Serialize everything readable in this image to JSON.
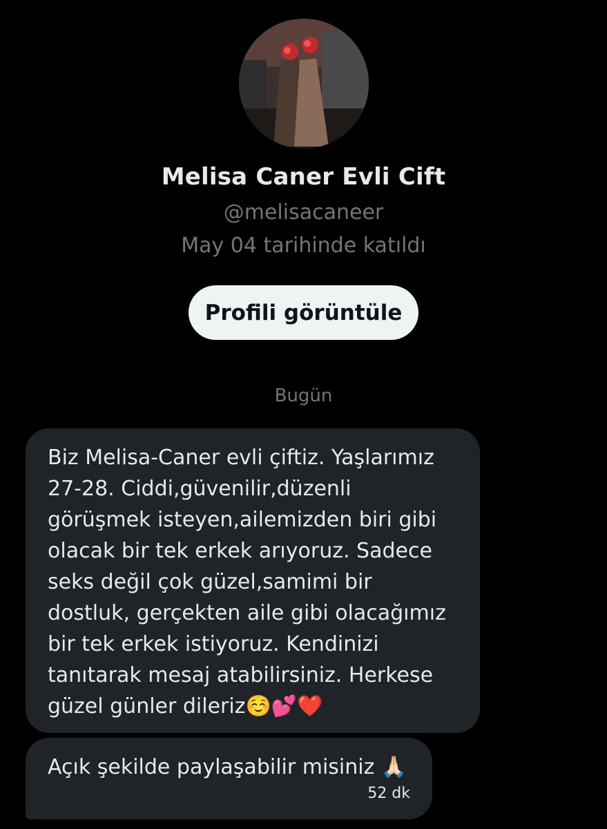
{
  "profile": {
    "display_name": "Melisa Caner Evli Cift",
    "handle": "@melisacaneer",
    "joined": "May 04 tarihinde katıldı",
    "view_profile_label": "Profili görüntüle"
  },
  "conversation": {
    "day_separator": "Bugün",
    "messages": [
      {
        "lines": [
          "Biz Melisa-Caner evli çiftiz. Yaşlarımız",
          "27-28. Ciddi,güvenilir,düzenli",
          "görüşmek isteyen,ailemizden biri gibi",
          "olacak bir tek erkek arıyoruz. Sadece",
          "seks değil çok güzel,samimi bir",
          "dostluk, gerçekten aile gibi olacağımız",
          "bir tek erkek istiyoruz. Kendinizi",
          "tanıtarak mesaj atabilirsiniz. Herkese",
          "güzel günler dileriz☺️💕❤️"
        ]
      },
      {
        "text": "Açık şekilde paylaşabilir misiniz 🙏🏻",
        "time": "52 dk"
      }
    ]
  },
  "colors": {
    "background": "#000000",
    "bubble": "#202327",
    "primary_text": "#e7e9ea",
    "secondary_text": "#71767b",
    "button_bg": "#eff3f4",
    "button_text": "#0f1419"
  }
}
